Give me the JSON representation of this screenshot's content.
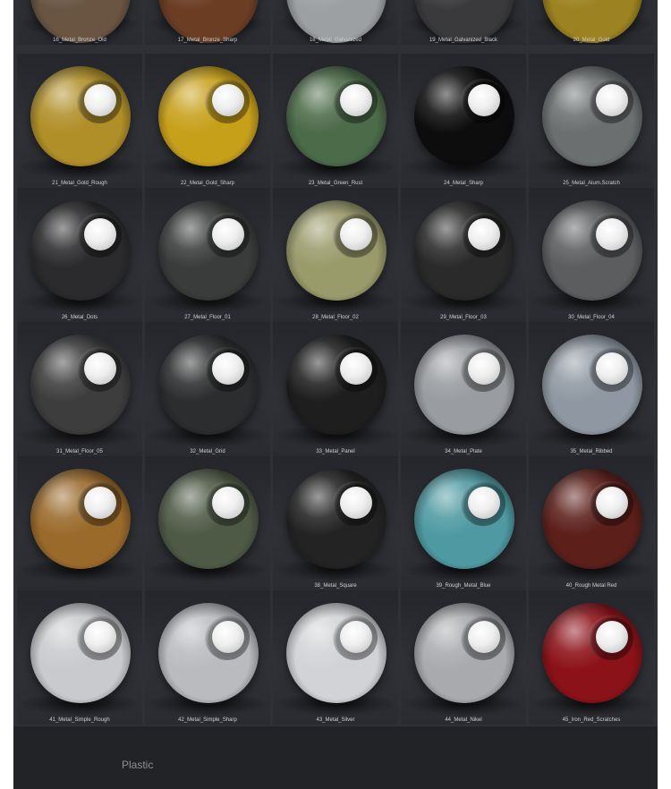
{
  "materials": [
    {
      "label": "16_Metal_Bronze_Old",
      "color": "#6a5543"
    },
    {
      "label": "17_Metal_Bronze_Sharp",
      "color": "#6b3e24"
    },
    {
      "label": "18_Metal_Galvanized",
      "color": "#9da0a2"
    },
    {
      "label": "19_Metal_Galvanized_Black",
      "color": "#3a3a3c"
    },
    {
      "label": "20_Metal_Gold",
      "color": "#9c8220"
    },
    {
      "label": "21_Metal_Gold_Rough",
      "color": "#b08f28"
    },
    {
      "label": "22_Metal_Gold_Sharp",
      "color": "#c7a01a"
    },
    {
      "label": "23_Metal_Green_Rust",
      "color": "#4c6b49"
    },
    {
      "label": "24_Metal_Sharp",
      "color": "#0d0d0e"
    },
    {
      "label": "25_Metal_Alum.Scratch",
      "color": "#6b6f70"
    },
    {
      "label": "26_Metal_Dots",
      "color": "#2b2b2d"
    },
    {
      "label": "27_Metal_Floor_01",
      "color": "#3a3c3b"
    },
    {
      "label": "28_Metal_Floor_02",
      "color": "#9a9b6b"
    },
    {
      "label": "29_Metal_Floor_03",
      "color": "#2a2a2a"
    },
    {
      "label": "30_Metal_Floor_04",
      "color": "#5c5d5f"
    },
    {
      "label": "31_Metal_Floor_05",
      "color": "#3d3d3e"
    },
    {
      "label": "32_Metal_Grid",
      "color": "#2c2d2e"
    },
    {
      "label": "33_Metal_Panel",
      "color": "#1e1e1f"
    },
    {
      "label": "34_Metal_Plate",
      "color": "#999ca0"
    },
    {
      "label": "35_Metal_Ribbed",
      "color": "#8f98a2"
    },
    {
      "label": "",
      "color": "#9a6a2b"
    },
    {
      "label": "",
      "color": "#4f5a46"
    },
    {
      "label": "38_Metal_Square",
      "color": "#232323"
    },
    {
      "label": "39_Rough_Metal_Blue",
      "color": "#4f9aa2"
    },
    {
      "label": "40_Rough Metal Red",
      "color": "#5c1f1a"
    },
    {
      "label": "41_Metal_Simple_Rough",
      "color": "#c9cacd"
    },
    {
      "label": "42_Metal_Simple_Sharp",
      "color": "#b9bbbf"
    },
    {
      "label": "43_Metal_Silver",
      "color": "#d2d3d6"
    },
    {
      "label": "44_Metal_Nikel",
      "color": "#a9aaae"
    },
    {
      "label": "45_Iron_Red_Scratches",
      "color": "#8b1218"
    }
  ],
  "footer": {
    "section_title": "Plastic"
  }
}
